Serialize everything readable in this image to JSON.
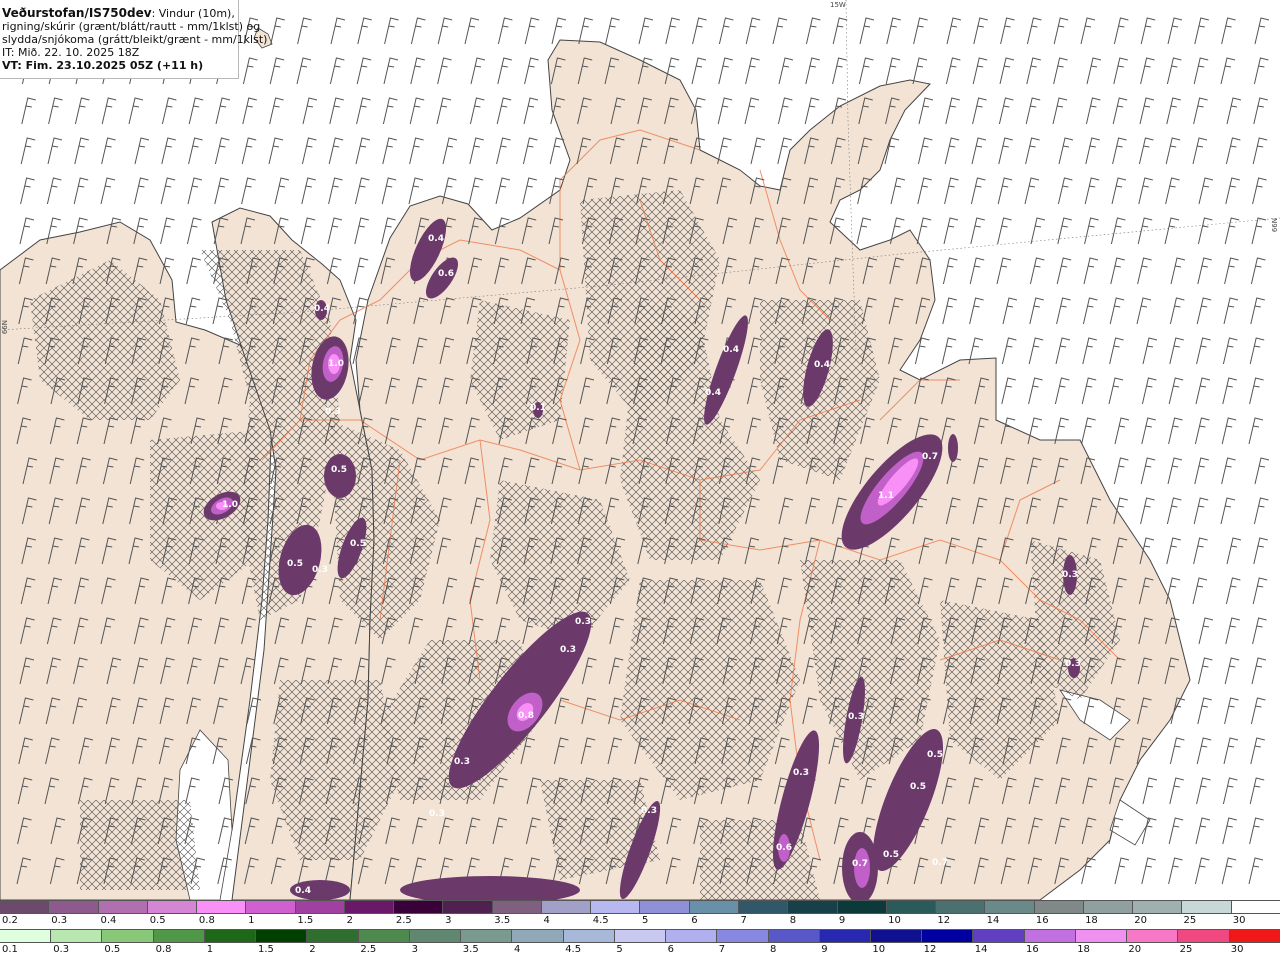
{
  "header": {
    "source": "Veðurstofan/IS750dev",
    "description_line1": ": Vindur (10m),",
    "description_line2": "rigning/skúrir (grænt/blátt/rautt - mm/1klst) og",
    "description_line3": "slydda/snjókoma (grátt/bleikt/grænt - mm/1klst)",
    "init_time": "IT: Mið. 22. 10. 2025 18Z",
    "valid_time": "VT: Fim. 23.10.2025 05Z (+11 h)"
  },
  "grid_labels": {
    "lon": "15W",
    "lat_left": "66N",
    "lat_right": "66N"
  },
  "precip_labels": [
    "0.4",
    "0.6",
    "0.4",
    "1.0",
    "0.3",
    "0.5",
    "1.0",
    "0.5",
    "0.5",
    "0.3",
    "0.4",
    "0.4",
    "0.4",
    "0.1",
    "0.7",
    "1.1",
    "0.3",
    "0.3",
    "0.3",
    "0.3",
    "0.8",
    "0.3",
    "0.3",
    "0.3",
    "0.3",
    "0.5",
    "0.5",
    "0.5",
    "0.3",
    "0.6",
    "0.7",
    "0.7",
    "0.4"
  ],
  "legend_snow": {
    "labels": [
      "0.2",
      "0.3",
      "0.4",
      "0.5",
      "0.8",
      "1",
      "1.5",
      "2",
      "2.5",
      "3",
      "3.5",
      "4",
      "4.5",
      "5",
      "6",
      "7",
      "8",
      "9",
      "10",
      "12",
      "14",
      "16",
      "18",
      "20",
      "25",
      "30"
    ],
    "colors": [
      "#6b4a6b",
      "#8c5a8c",
      "#b070b0",
      "#d486d4",
      "#f890f8",
      "#d060d0",
      "#a040a0",
      "#6a186a",
      "#3a003a",
      "#502050",
      "#806080",
      "#a0a0c8",
      "#b8b8f0",
      "#9090d8",
      "#6890a8",
      "#305868",
      "#184048",
      "#0c3a3a",
      "#2a5a5a",
      "#4a7070",
      "#6a8a8a",
      "#808888",
      "#90a0a0",
      "#a0b0b0",
      "#c8d8d8",
      "#ffffff"
    ]
  },
  "legend_rain": {
    "labels": [
      "0.1",
      "0.3",
      "0.5",
      "0.8",
      "1",
      "1.5",
      "2",
      "2.5",
      "3",
      "3.5",
      "4",
      "4.5",
      "5",
      "6",
      "7",
      "8",
      "9",
      "10",
      "12",
      "14",
      "16",
      "18",
      "20",
      "25",
      "30"
    ],
    "colors": [
      "#e0ffe0",
      "#b8e8b0",
      "#88c878",
      "#509848",
      "#1e6818",
      "#004000",
      "#2e6e2e",
      "#4e8a4e",
      "#608870",
      "#7a9a90",
      "#90a8b8",
      "#a8b8d8",
      "#c8c8f0",
      "#b0b0f0",
      "#8888e0",
      "#5858c8",
      "#2828b0",
      "#101090",
      "#0000a0",
      "#6040c0",
      "#c070e0",
      "#f090f0",
      "#f878c8",
      "#f04880",
      "#f01818"
    ]
  }
}
